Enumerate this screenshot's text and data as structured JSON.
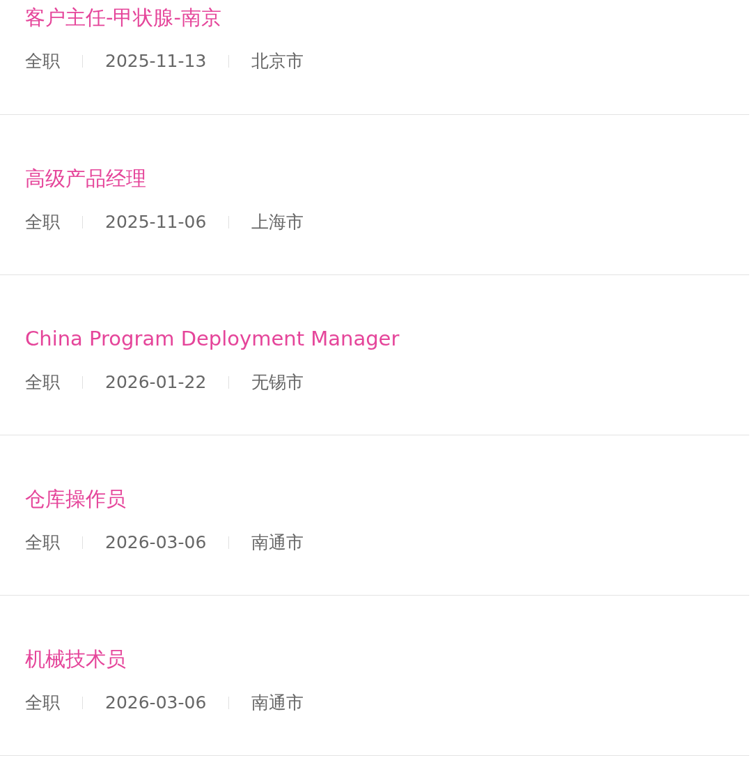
{
  "jobs": [
    {
      "title": "客户主任-甲状腺-南京",
      "type": "全职",
      "date": "2025-11-13",
      "city": "北京市"
    },
    {
      "title": "高级产品经理",
      "type": "全职",
      "date": "2025-11-06",
      "city": "上海市"
    },
    {
      "title": "China Program Deployment Manager",
      "type": "全职",
      "date": "2026-01-22",
      "city": "无锡市"
    },
    {
      "title": "仓库操作员",
      "type": "全职",
      "date": "2026-03-06",
      "city": "南通市"
    },
    {
      "title": "机械技术员",
      "type": "全职",
      "date": "2026-03-06",
      "city": "南通市"
    }
  ]
}
